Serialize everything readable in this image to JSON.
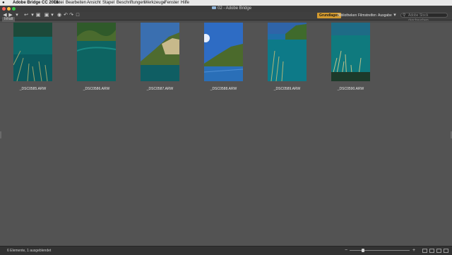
{
  "menubar": {
    "app_name": "Adobe Bridge CC 2018",
    "items": [
      "Datei",
      "Bearbeiten",
      "Ansicht",
      "Stapel",
      "Beschriftungen",
      "Werkzeuge",
      "Fenster",
      "Hilfe"
    ]
  },
  "window": {
    "title": "02 - Adobe Bridge"
  },
  "workspaces": {
    "items": [
      "Grundlagen",
      "Bibliotheken",
      "Filmstreifen",
      "Ausgabe"
    ],
    "active": "Grundlagen"
  },
  "search": {
    "placeholder": "Adobe Stock durchsuchen"
  },
  "content_tab": {
    "label": "Inhalt"
  },
  "thumbnails": [
    {
      "filename": "_DSC0585.ARW"
    },
    {
      "filename": "_DSC0586.ARW"
    },
    {
      "filename": "_DSC0587.ARW"
    },
    {
      "filename": "_DSC0588.ARW"
    },
    {
      "filename": "_DSC0589.ARW"
    },
    {
      "filename": "_DSC0590.ARW"
    }
  ],
  "status": {
    "text": "6 Elemente, 1 ausgeblendet"
  },
  "colors": {
    "accent": "#d39a2f",
    "background": "#535353",
    "panel": "#3f3f3f"
  }
}
